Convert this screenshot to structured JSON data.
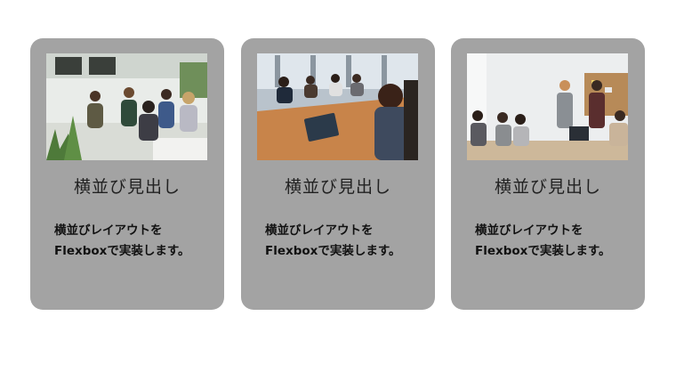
{
  "cards": [
    {
      "image": "meeting-photo-lounge",
      "title": "横並び見出し",
      "text_line1": "横並びレイアウトを",
      "text_line2": "Flexboxで実装します。"
    },
    {
      "image": "meeting-photo-conference-table",
      "title": "横並び見出し",
      "text_line1": "横並びレイアウトを",
      "text_line2": "Flexboxで実装します。"
    },
    {
      "image": "meeting-photo-presentation",
      "title": "横並び見出し",
      "text_line1": "横並びレイアウトを",
      "text_line2": "Flexboxで実装します。"
    }
  ],
  "colors": {
    "card_bg": "#a3a3a3",
    "page_bg": "#ffffff"
  }
}
